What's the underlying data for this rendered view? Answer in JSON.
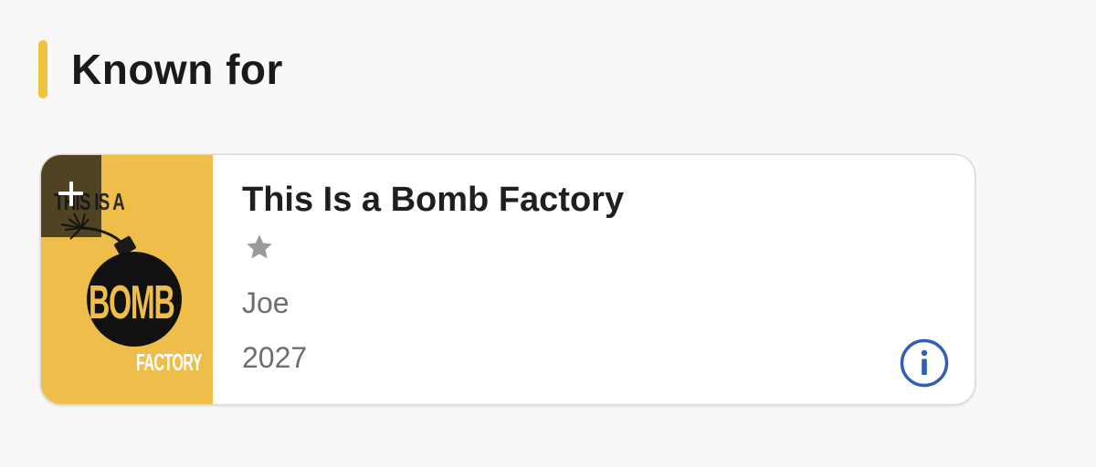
{
  "section": {
    "title": "Known for",
    "accent_color": "#f0c53e"
  },
  "card": {
    "title": "This Is a Bomb Factory",
    "role": "Joe",
    "year": "2027",
    "rating_icon": "star-icon",
    "info_icon": "info-circle-icon",
    "watchlist_icon": "plus-icon",
    "poster": {
      "text_top": "THIS IS A",
      "text_middle": "BOMB",
      "text_bottom": "FACTORY",
      "background_color": "#eebd4a"
    }
  },
  "colors": {
    "info_blue": "#2d5fb8",
    "star_gray": "#9a9a9a"
  }
}
